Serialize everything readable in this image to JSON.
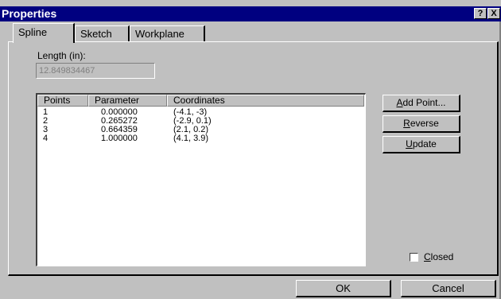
{
  "window": {
    "title": "Properties",
    "help_glyph": "?",
    "close_glyph": "X"
  },
  "tabs": [
    {
      "label": "Spline",
      "active": true
    },
    {
      "label": "Sketch",
      "active": false
    },
    {
      "label": "Workplane",
      "active": false
    }
  ],
  "length": {
    "label": "Length (in):",
    "value": "12.849834467"
  },
  "points_table": {
    "columns": [
      "Points",
      "Parameter",
      "Coordinates"
    ],
    "rows": [
      {
        "point": "1",
        "parameter": "0.000000",
        "coordinates": "(-4.1, -3)"
      },
      {
        "point": "2",
        "parameter": "0.265272",
        "coordinates": "(-2.9, 0.1)"
      },
      {
        "point": "3",
        "parameter": "0.664359",
        "coordinates": "(2.1, 0.2)"
      },
      {
        "point": "4",
        "parameter": "1.000000",
        "coordinates": "(4.1, 3.9)"
      }
    ]
  },
  "buttons": {
    "add_point": "Add Point...",
    "reverse": "Reverse",
    "update": "Update"
  },
  "closed": {
    "label": "Closed",
    "checked": false
  },
  "footer": {
    "ok": "OK",
    "cancel": "Cancel"
  }
}
